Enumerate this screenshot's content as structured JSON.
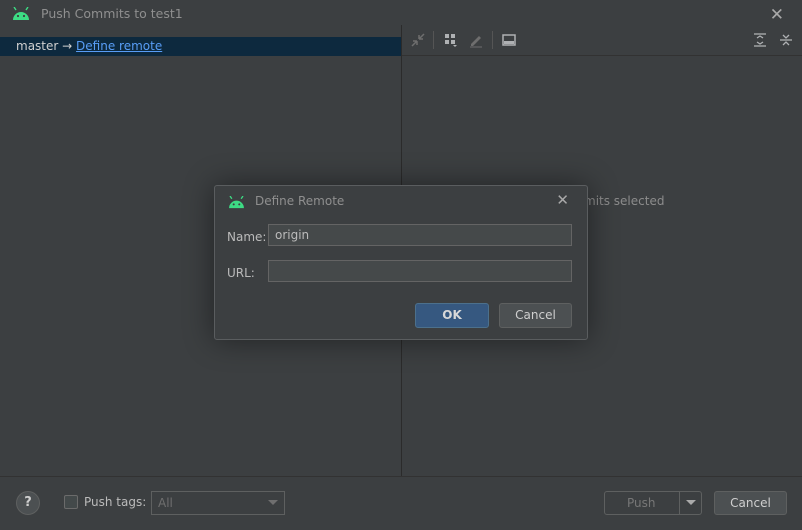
{
  "window": {
    "title": "Push Commits to test1"
  },
  "branch_row": {
    "branch": "master",
    "arrow": "→",
    "remote_link": "Define remote"
  },
  "commits_panel": {
    "empty_message": "mits selected"
  },
  "footer": {
    "help": "?",
    "push_tags_label": "Push tags:",
    "tags_select_value": "All",
    "push_button": "Push",
    "cancel_button": "Cancel"
  },
  "dialog": {
    "title": "Define Remote",
    "name_label": "Name:",
    "name_value": "origin",
    "url_label": "URL:",
    "url_value": "",
    "ok_button": "OK",
    "cancel_button": "Cancel"
  },
  "colors": {
    "android_green": "#3ddc84",
    "link_blue": "#589df6",
    "selection_bg": "#0d293e",
    "primary_button": "#365880"
  },
  "icons": [
    "android-logo",
    "close-icon",
    "expand-icon",
    "group-by-icon",
    "edit-icon",
    "show-details-icon",
    "expand-all-icon",
    "collapse-all-icon",
    "dropdown-arrow-icon"
  ]
}
